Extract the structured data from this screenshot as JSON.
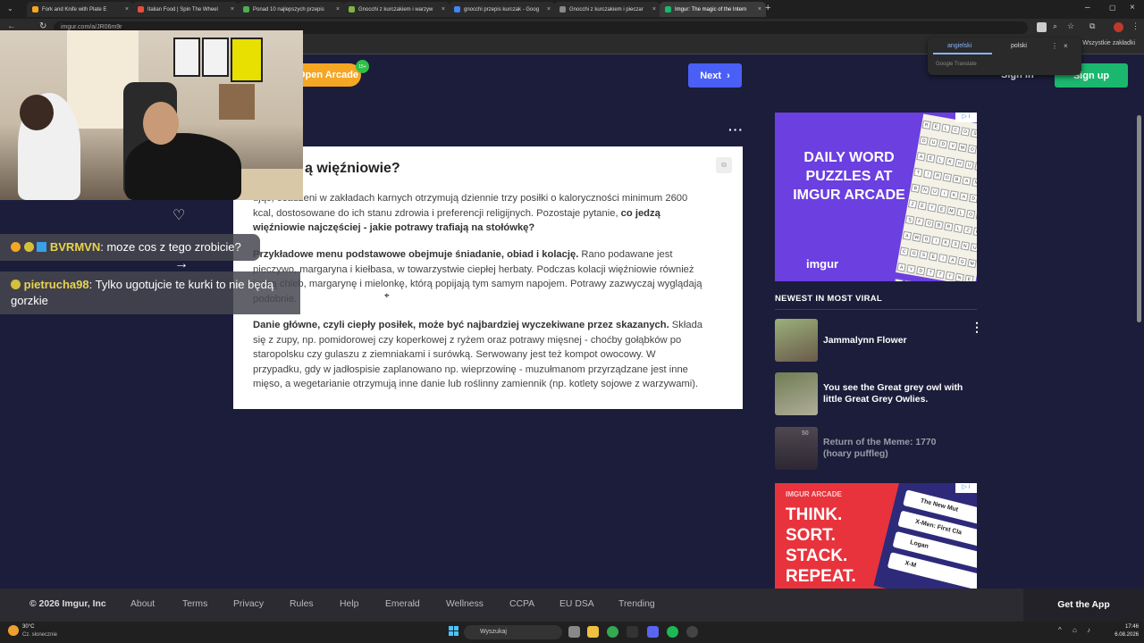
{
  "browser": {
    "tabs": [
      {
        "label": "Fork and Knife with Plate E",
        "color": "#f5a623"
      },
      {
        "label": "Italian Food | Spin The Wheel",
        "color": "#e84f3d"
      },
      {
        "label": "Ponad 10 najlepszych przepis",
        "color": "#4caf50"
      },
      {
        "label": "Gnocchi z kurczakiem i warzyw",
        "color": "#7cb342"
      },
      {
        "label": "gnocchi przepis kurczak - Goog",
        "color": "#4285f4"
      },
      {
        "label": "Gnocchi z kurczakiem i pieczar",
        "color": "#888888"
      },
      {
        "label": "Imgur: The magic of the Intern",
        "color": "#1bb76e"
      }
    ],
    "url": "imgur.com/a/JR06m9r",
    "bookmarks_all": "Wszystkie zakładki"
  },
  "translate": {
    "lang_from": "angielski",
    "lang_to": "polski",
    "provider": "Google Translate"
  },
  "imgur": {
    "open_arcade": "Open Arcade",
    "arcade_badge": "15+",
    "next": "Next",
    "sign_in": "Sign in",
    "sign_up": "Sign up",
    "post_title": "ą więźniowie?",
    "post_p1_a": "ując, osadzeni w zakładach karnych otrzymują dziennie trzy posiłki o kaloryczności minimum 2600 kcal, dostosowane do ich stanu zdrowia i preferencji religijnych. Pozostaje pytanie, ",
    "post_p1_b": "co jedzą więźniowie najczęściej - jakie potrawy trafiają na stołówkę?",
    "post_p2_a": "Przykładowe menu podstawowe obejmuje śniadanie, obiad i kolację.",
    "post_p2_b": " Rano podawane jest pieczywo, margaryna i kiełbasa, w towarzystwie ciepłej herbaty. Podczas kolacji więźniowie również jedzą chleb, margarynę i mielonkę, którą popijają tym samym napojem. Potrawy zazwyczaj wyglądają podobnie.",
    "post_p3_a": "Danie główne, czyli ciepły posiłek, może być najbardziej wyczekiwane przez skazanych.",
    "post_p3_b": " Składa się z zupy, np. pomidorowej czy koperkowej z ryżem oraz potrawy mięsnej - choćby gołąbków po staropolsku czy gulaszu z ziemniakami i surówką. Serwowany jest też kompot owocowy. W przypadku, gdy w jadłospisie zaplanowano np. wieprzowinę - muzułmanom przyrządzane jest inne mięso, a wegetarianie otrzymują inne danie lub roślinny zamiennik (np. kotlety sojowe z warzywami).",
    "ad1_text": "DAILY WORD PUZZLES AT IMGUR ARCADE",
    "ad1_logo": "imgur",
    "ad_grid_letters": "RELCOSYSOUDVMOWLAELKHUSATIROBANDBNUIKADOZEYEMLOISFOBRLZOAWGIKSNUCOSEIAGMAYDTTYNEARFOLEILCOOIIEGEOSYRUIAELINETSUMIOSONAMLGR",
    "viral_header": "NEWEST IN MOST VIRAL",
    "viral_items": [
      {
        "title": "Jammalynn Flower",
        "thumb": "#7a8a6a"
      },
      {
        "title": "You see the Great grey owl with little Great Grey Owlies.",
        "thumb": "#8a8f7a"
      },
      {
        "title": "Return of the Meme: 1770 (hoary puffleg)",
        "thumb": "#5a4a44",
        "count": "50"
      }
    ],
    "ad2_head": "IMGUR ARCADE",
    "ad2_text": "THINK. SORT. STACK. REPEAT.",
    "ad2_rows": [
      "The New Mut",
      "X-Men: First Cla",
      "Logan",
      "X-M"
    ],
    "footer": {
      "copyright": "© 2026 Imgur, Inc",
      "links": [
        "About",
        "Terms",
        "Privacy",
        "Rules",
        "Help",
        "Emerald",
        "Wellness",
        "CCPA",
        "EU DSA",
        "Trending"
      ],
      "get_app": "Get the App"
    }
  },
  "stream_chat": {
    "messages": [
      {
        "user": "BVRMVN",
        "text": ": moze cos z tego zrobicie?"
      },
      {
        "user": "pietrucha98",
        "text": ": Tylko ugotujcie te kurki to nie będą gorzkie"
      }
    ]
  },
  "taskbar": {
    "weather_temp": "30°C",
    "weather_desc": "Cz. słonecznie",
    "search": "Wyszukaj",
    "time": "17:46",
    "date": "6.08.2026"
  }
}
